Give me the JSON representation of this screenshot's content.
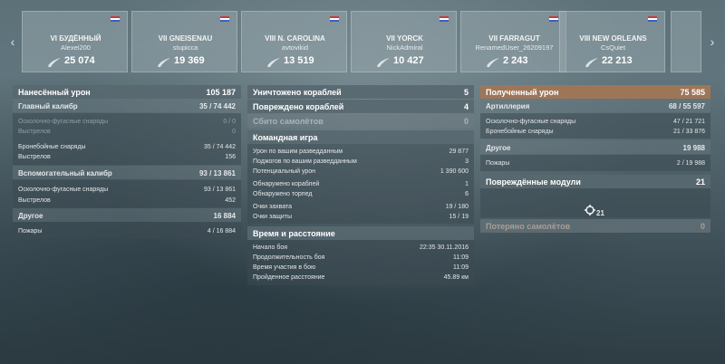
{
  "carousel": {
    "left_arrow": "‹",
    "right_arrow": "›",
    "ships": [
      {
        "name": "VI БУДЁННЫЙ",
        "player": "Alexei200",
        "damage": "25 074"
      },
      {
        "name": "VII GNEISENAU",
        "player": "stupicca",
        "damage": "19 369"
      },
      {
        "name": "VIII N. CAROLINA",
        "player": "avtovikid",
        "damage": "13 519"
      },
      {
        "name": "VII YORCK",
        "player": "NickAdmiral",
        "damage": "10 427"
      },
      {
        "name": "VII FARRAGUT",
        "player": "RenamedUser_26209197",
        "damage": "2 243"
      },
      {
        "name": "VIII NEW ORLEANS",
        "player": "CsQuiet",
        "damage": "22 213"
      }
    ]
  },
  "damage_dealt": {
    "title": "Нанесённый урон",
    "total": "105 187",
    "main_battery": {
      "label": "Главный калибр",
      "value": "35 / 74 442"
    },
    "mb_he": {
      "label": "Осколочно-фугасные снаряды",
      "value": "0 / 0"
    },
    "mb_he_shots": {
      "label": "Выстрелов",
      "value": "0"
    },
    "mb_ap": {
      "label": "Бронебойные снаряды",
      "value": "35 / 74 442"
    },
    "mb_ap_shots": {
      "label": "Выстрелов",
      "value": "156"
    },
    "secondary": {
      "label": "Вспомогательный калибр",
      "value": "93 / 13 861"
    },
    "sec_he": {
      "label": "Осколочно-фугасные снаряды",
      "value": "93 / 13 861"
    },
    "sec_shots": {
      "label": "Выстрелов",
      "value": "452"
    },
    "other": {
      "label": "Другое",
      "value": "16 884"
    },
    "fires": {
      "label": "Пожары",
      "value": "4 / 16 884"
    }
  },
  "middle": {
    "ships_destroyed": {
      "label": "Уничтожено кораблей",
      "value": "5"
    },
    "ships_damaged": {
      "label": "Повреждено кораблей",
      "value": "4"
    },
    "planes_shot": {
      "label": "Сбито самолётов",
      "value": "0"
    },
    "team_play": {
      "title": "Командная игра",
      "spot_damage": {
        "label": "Урон по вашим разведданным",
        "value": "29 877"
      },
      "spot_fires": {
        "label": "Поджогов по вашим разведданным",
        "value": "3"
      },
      "potential": {
        "label": "Потенциальный урон",
        "value": "1 390 600"
      },
      "spotted_ships": {
        "label": "Обнаружено кораблей",
        "value": "1"
      },
      "spotted_torps": {
        "label": "Обнаружено торпед",
        "value": "6"
      },
      "capture_pts": {
        "label": "Очки захвата",
        "value": "19 / 180"
      },
      "defense_pts": {
        "label": "Очки защиты",
        "value": "15 / 19"
      }
    },
    "time_distance": {
      "title": "Время и расстояние",
      "start": {
        "label": "Начало боя",
        "value": "22:35  30.11.2016"
      },
      "duration": {
        "label": "Продолжительность боя",
        "value": "11:09"
      },
      "participation": {
        "label": "Время участия в бою",
        "value": "11:09"
      },
      "distance": {
        "label": "Пройденное расстояние",
        "value": "45.89 км"
      }
    }
  },
  "damage_received": {
    "title": "Полученный урон",
    "total": "75 585",
    "artillery": {
      "label": "Артиллерия",
      "value": "68 / 55 597"
    },
    "art_he": {
      "label": "Осколочно-фугасные снаряды",
      "value": "47 / 21 721"
    },
    "art_ap": {
      "label": "Бронебойные снаряды",
      "value": "21 / 33 876"
    },
    "other": {
      "label": "Другое",
      "value": "19 988"
    },
    "fires": {
      "label": "Пожары",
      "value": "2 / 19 988"
    },
    "modules": {
      "label": "Повреждённые модули",
      "value": "21",
      "icon_count": "21"
    },
    "planes_lost": {
      "label": "Потеряно самолётов",
      "value": "0"
    }
  }
}
